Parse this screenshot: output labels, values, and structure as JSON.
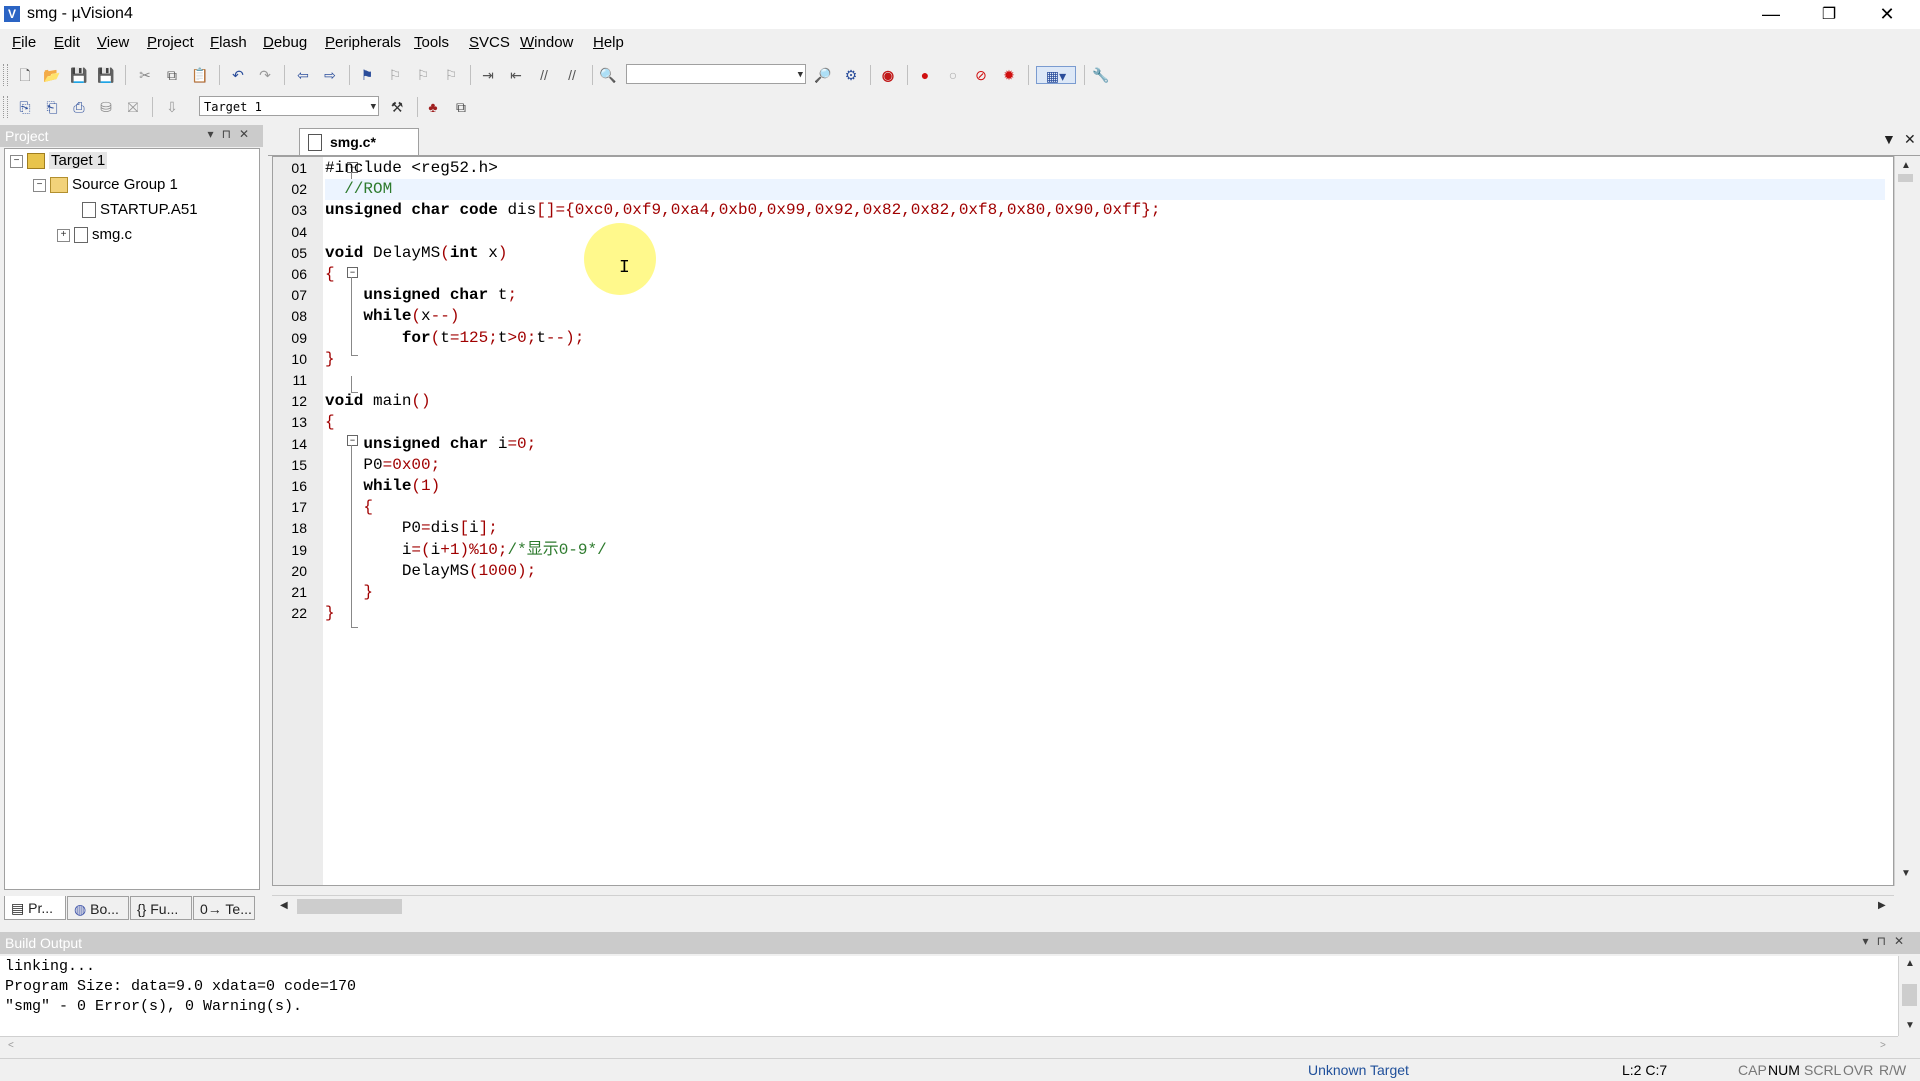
{
  "window": {
    "title": "smg - µVision4",
    "app_icon_glyph": "V",
    "minimize_glyph": "—",
    "maximize_glyph": "❐",
    "close_glyph": "✕"
  },
  "menu": [
    "File",
    "Edit",
    "View",
    "Project",
    "Flash",
    "Debug",
    "Peripherals",
    "Tools",
    "SVCS",
    "Window",
    "Help"
  ],
  "toolbar": {
    "find_combo_value": "",
    "target_combo_value": "Target 1"
  },
  "project_pane": {
    "title": "Project",
    "tree": {
      "target": "Target 1",
      "group": "Source Group 1",
      "files": [
        "STARTUP.A51",
        "smg.c"
      ]
    },
    "tabs": [
      "Pr...",
      "Bo...",
      "{} Fu...",
      "0→ Te..."
    ]
  },
  "editor": {
    "tab_label": "smg.c*",
    "line_numbers": [
      "01",
      "02",
      "03",
      "04",
      "05",
      "06",
      "07",
      "08",
      "09",
      "10",
      "11",
      "12",
      "13",
      "14",
      "15",
      "16",
      "17",
      "18",
      "19",
      "20",
      "21",
      "22"
    ],
    "lines": [
      "#include <reg52.h>",
      "  //ROM",
      "unsigned char code dis[]={0xc0,0xf9,0xa4,0xb0,0x99,0x92,0x82,0x82,0xf8,0x80,0x90,0xff};",
      "",
      "void DelayMS(int x)",
      "{",
      "    unsigned char t;",
      "    while(x--)",
      "        for(t=125;t>0;t--);",
      "}",
      "",
      "void main()",
      "{",
      "    unsigned char i=0;",
      "    P0=0x00;",
      "    while(1)",
      "    {",
      "        P0=dis[i];",
      "        i=(i+1)%10;/*显示0-9*/",
      "        DelayMS(1000);",
      "    }",
      "}"
    ],
    "current_line": 2
  },
  "build_output": {
    "title": "Build Output",
    "lines": [
      "linking...",
      "Program Size: data=9.0 xdata=0 code=170",
      "\"smg\" - 0 Error(s), 0 Warning(s)."
    ]
  },
  "status_bar": {
    "target": "Unknown Target",
    "position": "L:2 C:7",
    "cap": "CAP",
    "num": "NUM",
    "scrl": "SCRL",
    "ovr": "OVR",
    "rw": "R/W"
  },
  "colors": {
    "keyword": "#000000",
    "number": "#a00000",
    "comment": "#2d7a2d",
    "pane_header": "#cbcbcb",
    "current_line": "#ecf4ff",
    "status_target": "#1f4f9a"
  }
}
